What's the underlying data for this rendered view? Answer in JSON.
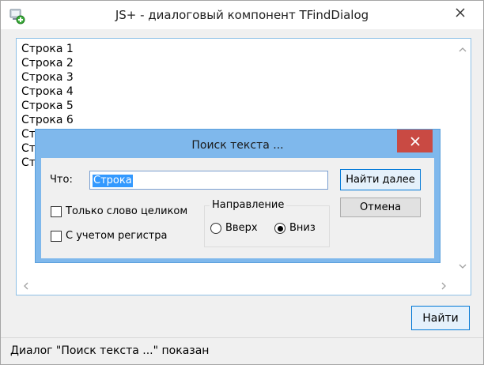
{
  "window": {
    "title": "JS+ - диалоговый компонент TFindDialog",
    "app_icon": "app-icon",
    "close_icon": "close-icon"
  },
  "memo": {
    "lines": [
      "Строка 1",
      "Строка 2",
      "Строка 3",
      "Строка 4",
      "Строка 5",
      "Строка 6",
      "Ст",
      "Ст",
      "Ст"
    ]
  },
  "buttons": {
    "find": "Найти"
  },
  "status": {
    "text": "Диалог \"Поиск текста ...\" показан"
  },
  "dialog": {
    "title": "Поиск текста ...",
    "what_label": "Что:",
    "search_value": "Строка",
    "find_next": "Найти далее",
    "cancel": "Отмена",
    "whole_word": "Только слово целиком",
    "match_case": "С учетом регистра",
    "direction_title": "Направление",
    "up": "Вверх",
    "down": "Вниз",
    "direction_selected": "down",
    "whole_word_checked": false,
    "match_case_checked": false
  },
  "colors": {
    "dialog_frame": "#7fb8ec",
    "close_red": "#c94a43",
    "selection": "#3399ff",
    "memo_border": "#8ec0e6"
  }
}
